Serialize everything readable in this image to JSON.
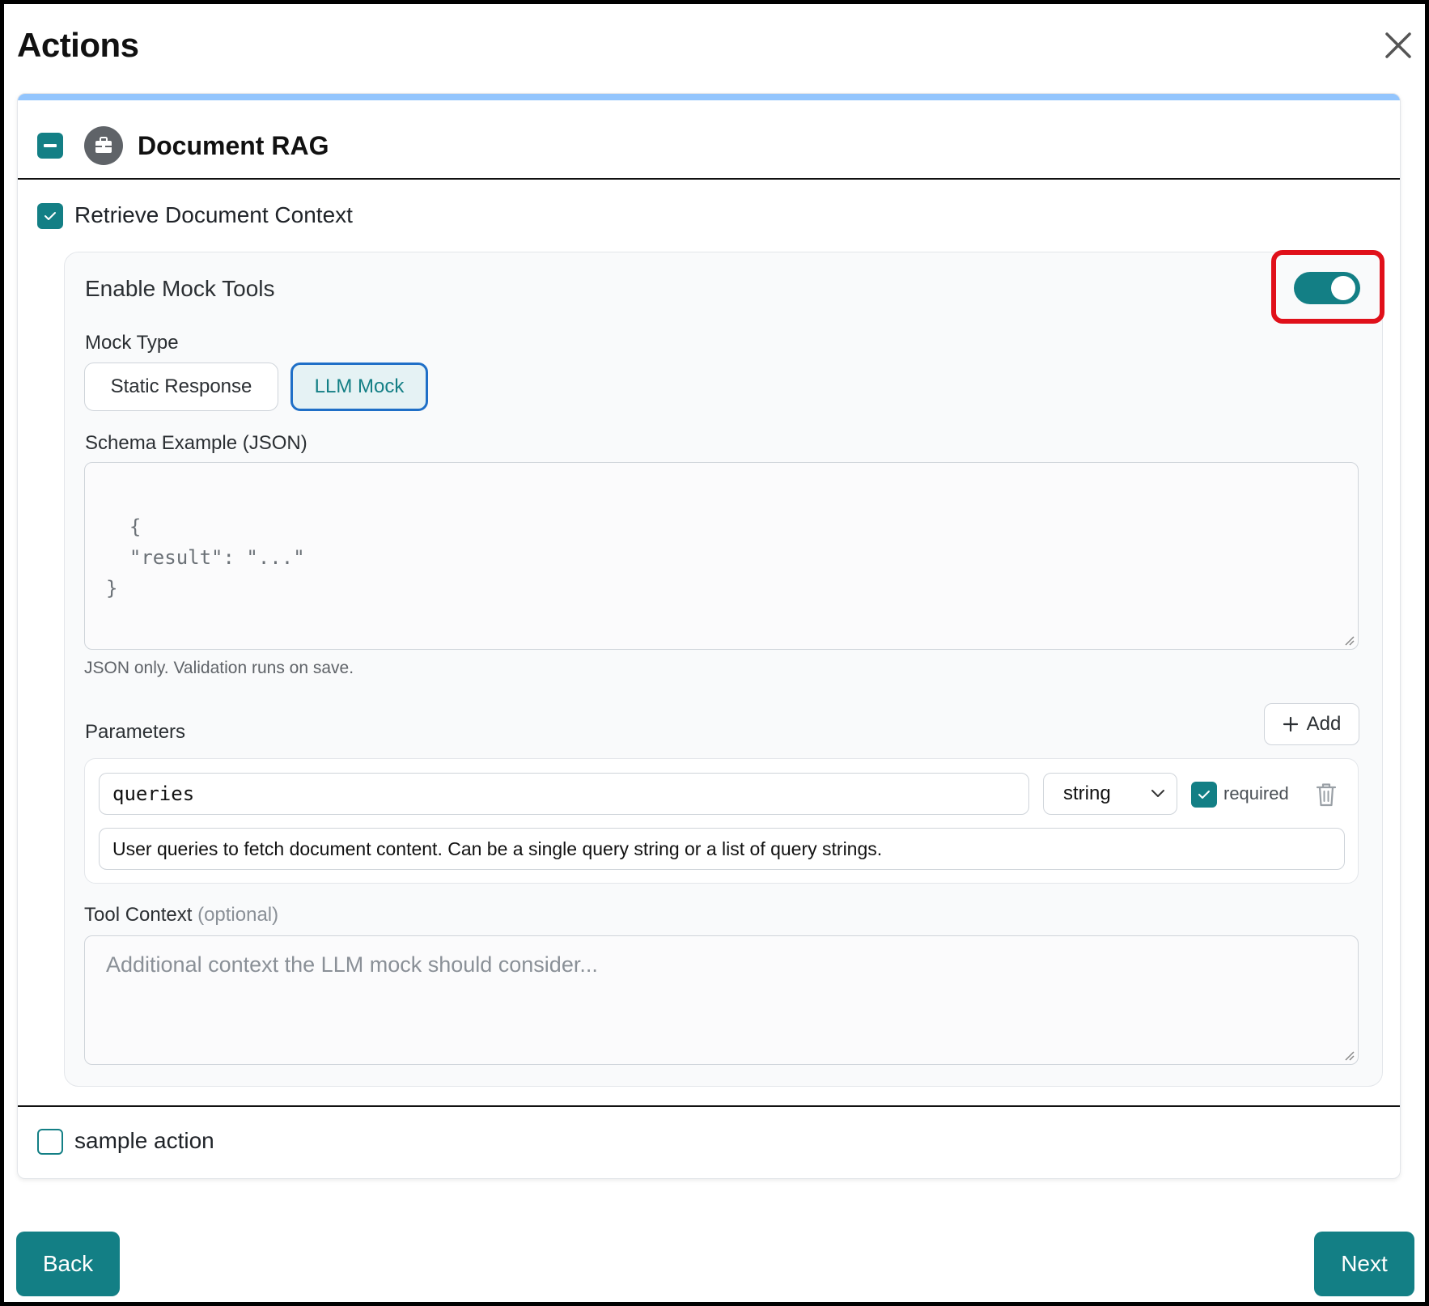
{
  "modal": {
    "title": "Actions"
  },
  "group": {
    "title": "Document RAG"
  },
  "actions": [
    {
      "label": "Retrieve Document Context",
      "checked": true
    },
    {
      "label": "sample action",
      "checked": false
    }
  ],
  "mock": {
    "enable_label": "Enable Mock Tools",
    "enabled": true,
    "type_label": "Mock Type",
    "types": [
      {
        "label": "Static Response",
        "selected": false
      },
      {
        "label": "LLM Mock",
        "selected": true
      }
    ],
    "schema_label": "Schema Example (JSON)",
    "schema_placeholder": "{\n  \"result\": \"...\"\n}",
    "schema_hint": "JSON only. Validation runs on save.",
    "parameters_label": "Parameters",
    "add_label": "Add",
    "parameters": [
      {
        "name": "queries",
        "type": "string",
        "required_label": "required",
        "required": true,
        "description": "User queries to fetch document content. Can be a single query string or a list of query strings."
      }
    ],
    "tool_context_label": "Tool Context",
    "tool_context_optional": "(optional)",
    "tool_context_placeholder": "Additional context the LLM mock should consider..."
  },
  "footer": {
    "back_label": "Back",
    "next_label": "Next"
  },
  "colors": {
    "accent": "#137f85",
    "highlight": "#e0101a",
    "selected_border": "#1f6fc7",
    "group_topbar": "#93c5fd"
  }
}
